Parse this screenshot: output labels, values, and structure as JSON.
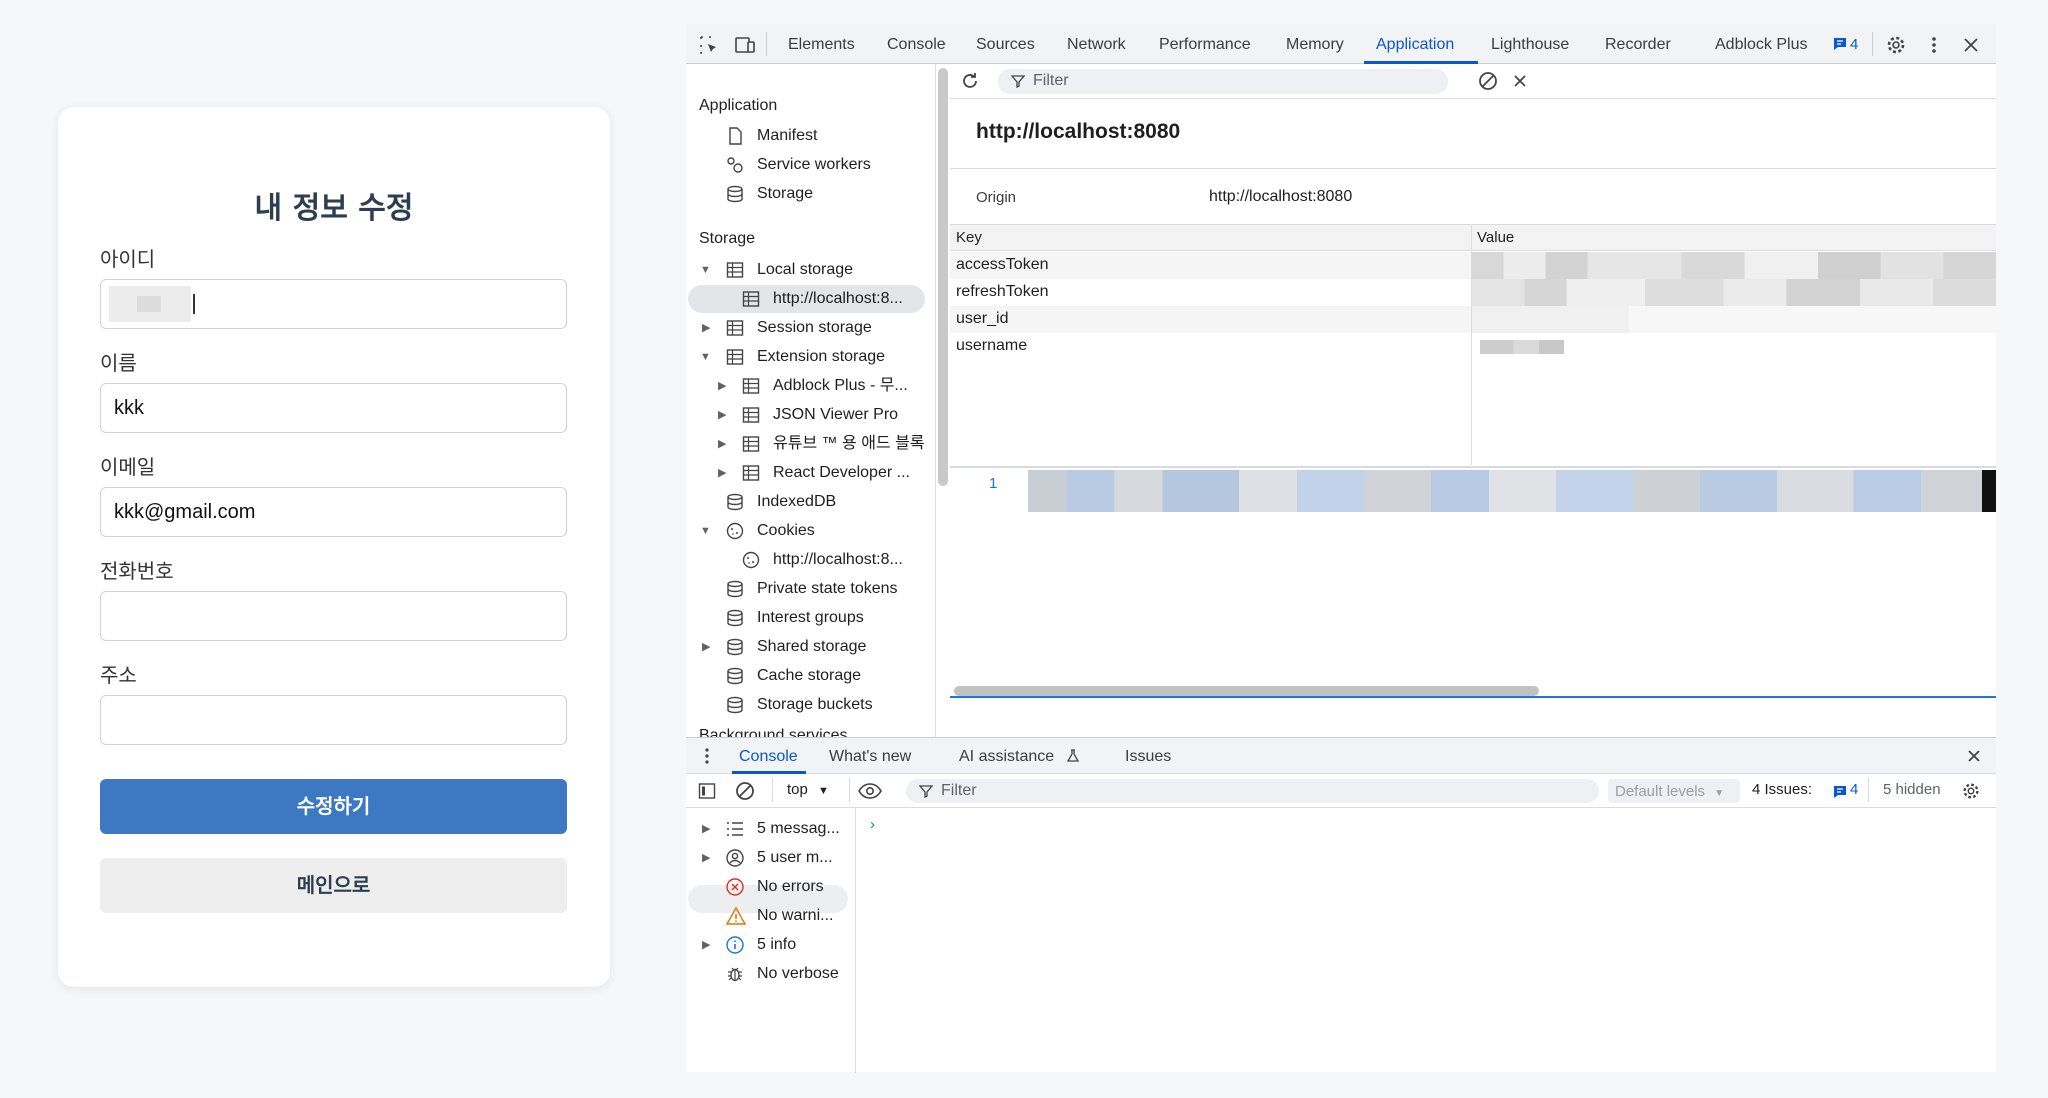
{
  "form": {
    "title": "내 정보 수정",
    "fields": [
      {
        "label": "아이디",
        "value": ""
      },
      {
        "label": "이름",
        "value": "kkk"
      },
      {
        "label": "이메일",
        "value": "kkk@gmail.com"
      },
      {
        "label": "전화번호",
        "value": ""
      },
      {
        "label": "주소",
        "value": ""
      }
    ],
    "submit_label": "수정하기",
    "main_label": "메인으로"
  },
  "devtools": {
    "tabs": [
      "Elements",
      "Console",
      "Sources",
      "Network",
      "Performance",
      "Memory",
      "Application",
      "Lighthouse",
      "Recorder",
      "Adblock Plus"
    ],
    "active_tab": "Application",
    "issues_badge": "4",
    "sidebar": {
      "app_header": "Application",
      "app_items": [
        "Manifest",
        "Service workers",
        "Storage"
      ],
      "storage_header": "Storage",
      "storage_items": [
        "Local storage",
        "http://localhost:8...",
        "Session storage",
        "Extension storage",
        "Adblock Plus - 무...",
        "JSON Viewer Pro",
        "유튜브 ™ 용 애드 블록",
        "React Developer ...",
        "IndexedDB",
        "Cookies",
        "http://localhost:8...",
        "Private state tokens",
        "Interest groups",
        "Shared storage",
        "Cache storage",
        "Storage buckets"
      ],
      "bg_header": "Background services"
    },
    "storage": {
      "filter_placeholder": "Filter",
      "origin_title": "http://localhost:8080",
      "origin_label": "Origin",
      "origin_value": "http://localhost:8080",
      "columns": [
        "Key",
        "Value"
      ],
      "keys": [
        "accessToken",
        "refreshToken",
        "user_id",
        "username"
      ],
      "preview_line": "1"
    },
    "drawer": {
      "tabs": [
        "Console",
        "What's new",
        "AI assistance",
        "Issues"
      ],
      "context": "top",
      "filter_placeholder": "Filter",
      "levels": "Default levels",
      "issues_label": "4 Issues:",
      "issues_count": "4",
      "hidden_label": "5 hidden",
      "sidebar_items": [
        "5 messag...",
        "5 user m...",
        "No errors",
        "No warni...",
        "5 info",
        "No verbose"
      ],
      "prompt": "›"
    }
  },
  "colors": {
    "primary_button": "#3d78c2",
    "active_tab": "#0b57d0",
    "error": "#d93025",
    "warning": "#e37400",
    "info": "#1a73e8"
  }
}
